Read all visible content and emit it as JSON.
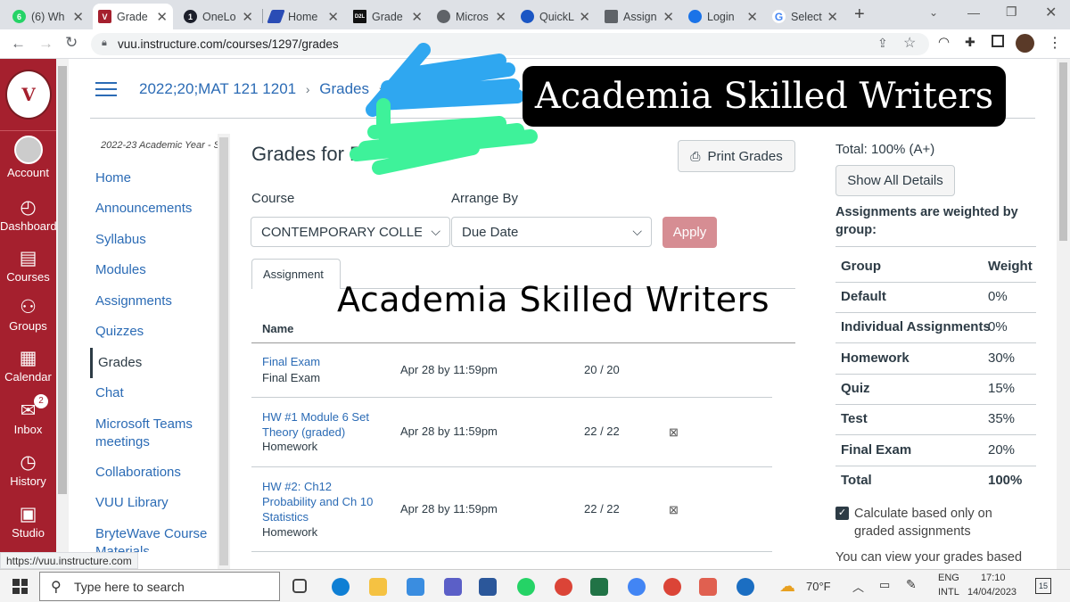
{
  "browser": {
    "tabs": [
      {
        "label": "(6) Wh",
        "icon": "whatsapp-icon",
        "color": "#25d366",
        "badge": "6"
      },
      {
        "label": "Grade",
        "icon": "canvas-logo-icon",
        "color": "#a5202e",
        "badge": "V"
      },
      {
        "label": "OneLo",
        "icon": "onelogin-icon",
        "color": "#1c1f2a",
        "badge": "1"
      },
      {
        "label": "Home",
        "icon": "home-icon",
        "color": "#2a4cb5",
        "badge": ""
      },
      {
        "label": "Grade",
        "icon": "d2l-icon",
        "color": "#111",
        "badge": "D2L"
      },
      {
        "label": "Micros",
        "icon": "globe-icon",
        "color": "#5f6368",
        "badge": ""
      },
      {
        "label": "QuickL",
        "icon": "quicklaunch-icon",
        "color": "#1a56c4",
        "badge": ""
      },
      {
        "label": "Assign",
        "icon": "doc-icon",
        "color": "#5f6368",
        "badge": ""
      },
      {
        "label": "Login",
        "icon": "login-icon",
        "color": "#1a73e8",
        "badge": ""
      },
      {
        "label": "Select",
        "icon": "google-icon",
        "color": "#4285f4",
        "badge": "G"
      }
    ],
    "url": "vuu.instructure.com/courses/1297/grades",
    "status_url": "https://vuu.instructure.com"
  },
  "global_nav": [
    {
      "label": "Account",
      "icon": "account-icon"
    },
    {
      "label": "Dashboard",
      "icon": "dashboard-icon"
    },
    {
      "label": "Courses",
      "icon": "courses-icon"
    },
    {
      "label": "Groups",
      "icon": "groups-icon"
    },
    {
      "label": "Calendar",
      "icon": "calendar-icon"
    },
    {
      "label": "Inbox",
      "icon": "inbox-icon",
      "badge": "2"
    },
    {
      "label": "History",
      "icon": "history-icon"
    },
    {
      "label": "Studio",
      "icon": "studio-icon"
    }
  ],
  "breadcrumb": {
    "course": "2022;20;MAT 121 1201",
    "page": "Grades"
  },
  "course_nav": {
    "term": "2022-23 Academic Year - S...",
    "items": [
      "Home",
      "Announcements",
      "Syllabus",
      "Modules",
      "Assignments",
      "Quizzes",
      "Grades",
      "Chat",
      "Microsoft Teams meetings",
      "Collaborations",
      "VUU Library",
      "BryteWave Course Materials"
    ]
  },
  "main": {
    "title": "Grades for R",
    "print_label": "Print Grades",
    "course_label": "Course",
    "course_value": "CONTEMPORARY COLLEGE",
    "arrange_label": "Arrange By",
    "arrange_value": "Due Date",
    "apply_label": "Apply",
    "tab_assignments": "Assignment",
    "col_name": "Name",
    "rows": [
      {
        "name": "Final Exam",
        "group": "Final Exam",
        "due": "Apr 28 by 11:59pm",
        "score": "20 / 20",
        "icon": false
      },
      {
        "name": "HW #1 Module 6 Set Theory (graded)",
        "group": "Homework",
        "due": "Apr 28 by 11:59pm",
        "score": "22 / 22",
        "icon": true
      },
      {
        "name": "HW #2: Ch12 Probability and Ch 10 Statistics",
        "group": "Homework",
        "due": "Apr 28 by 11:59pm",
        "score": "22 / 22",
        "icon": true
      }
    ]
  },
  "sidebar": {
    "total": "Total: 100% (A+)",
    "show_details": "Show All Details",
    "weighted_note": "Assignments are weighted by group:",
    "col_group": "Group",
    "col_weight": "Weight",
    "groups": [
      {
        "name": "Default",
        "weight": "0%"
      },
      {
        "name": "Individual Assignments",
        "weight": "0%"
      },
      {
        "name": "Homework",
        "weight": "30%"
      },
      {
        "name": "Quiz",
        "weight": "15%"
      },
      {
        "name": "Test",
        "weight": "35%"
      },
      {
        "name": "Final Exam",
        "weight": "20%"
      },
      {
        "name": "Total",
        "weight": "100%"
      }
    ],
    "calc_label": "Calculate based only on graded assignments",
    "more_text": "You can view your grades based"
  },
  "overlays": {
    "banner": "Academia Skilled Writers",
    "watermark": "Academia Skilled Writers"
  },
  "taskbar": {
    "search": "Type here to search",
    "weather": "70°F",
    "lang1": "ENG",
    "lang2": "INTL",
    "time": "17:10",
    "date": "14/04/2023",
    "notif": "15"
  },
  "colors": {
    "canvas_red": "#a5202e",
    "link": "#2b6bb5",
    "apply": "#d68d93",
    "blue_scribble": "#2fa7f0",
    "green_scribble": "#3ef29a"
  }
}
